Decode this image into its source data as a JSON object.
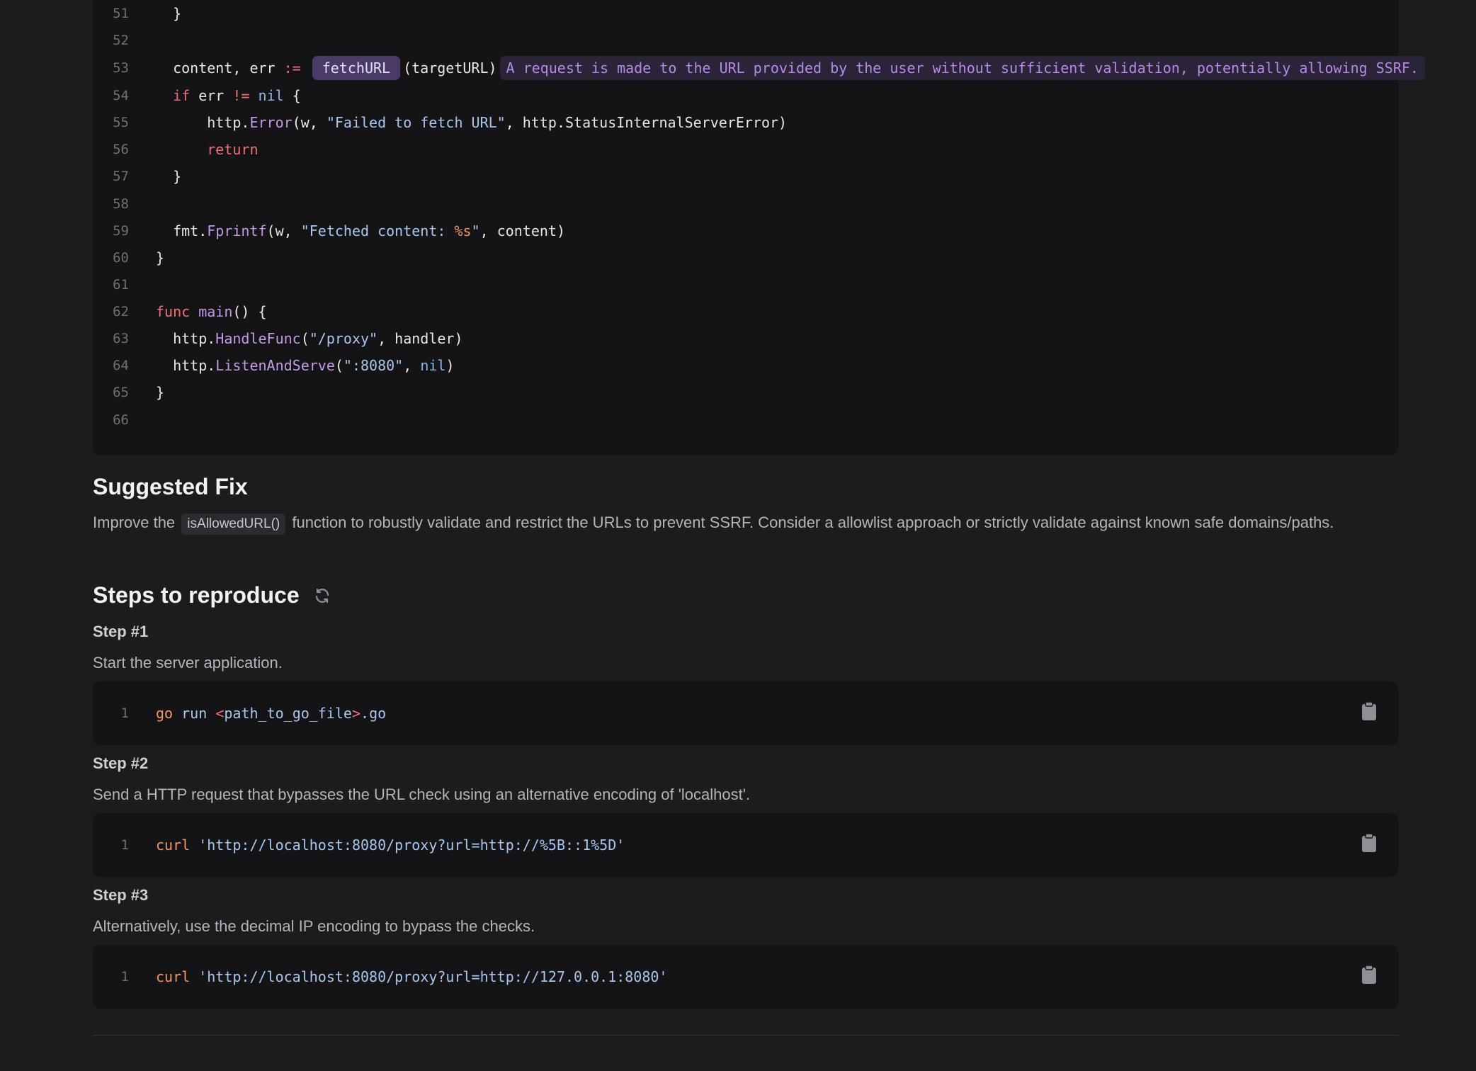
{
  "code": {
    "lines": [
      {
        "n": "51"
      },
      {
        "n": "52"
      },
      {
        "n": "53"
      },
      {
        "n": "54"
      },
      {
        "n": "55"
      },
      {
        "n": "56"
      },
      {
        "n": "57"
      },
      {
        "n": "58"
      },
      {
        "n": "59"
      },
      {
        "n": "60"
      },
      {
        "n": "61"
      },
      {
        "n": "62"
      },
      {
        "n": "63"
      },
      {
        "n": "64"
      },
      {
        "n": "65"
      },
      {
        "n": "66"
      }
    ],
    "highlight_function": "fetchURL",
    "annotation": "A request is made to the URL provided by the user without sufficient validation, potentially allowing SSRF."
  },
  "fix": {
    "title": "Suggested Fix",
    "text_before": "Improve the",
    "code": "isAllowedURL()",
    "text_after": "function to robustly validate and restrict the URLs to prevent SSRF. Consider a allowlist approach or strictly validate against known safe domains/paths."
  },
  "steps_section": {
    "title": "Steps to reproduce",
    "steps": [
      {
        "title": "Step #1",
        "desc": "Start the server application.",
        "line": "1"
      },
      {
        "title": "Step #2",
        "desc": "Send a HTTP request that bypasses the URL check using an alternative encoding of 'localhost'.",
        "line": "1"
      },
      {
        "title": "Step #3",
        "desc": "Alternatively, use the decimal IP encoding to bypass the checks.",
        "line": "1"
      }
    ]
  },
  "colors": {
    "background": "#1c1c1f",
    "code_bg": "#141416",
    "accent_purple": "#b78ae6"
  }
}
